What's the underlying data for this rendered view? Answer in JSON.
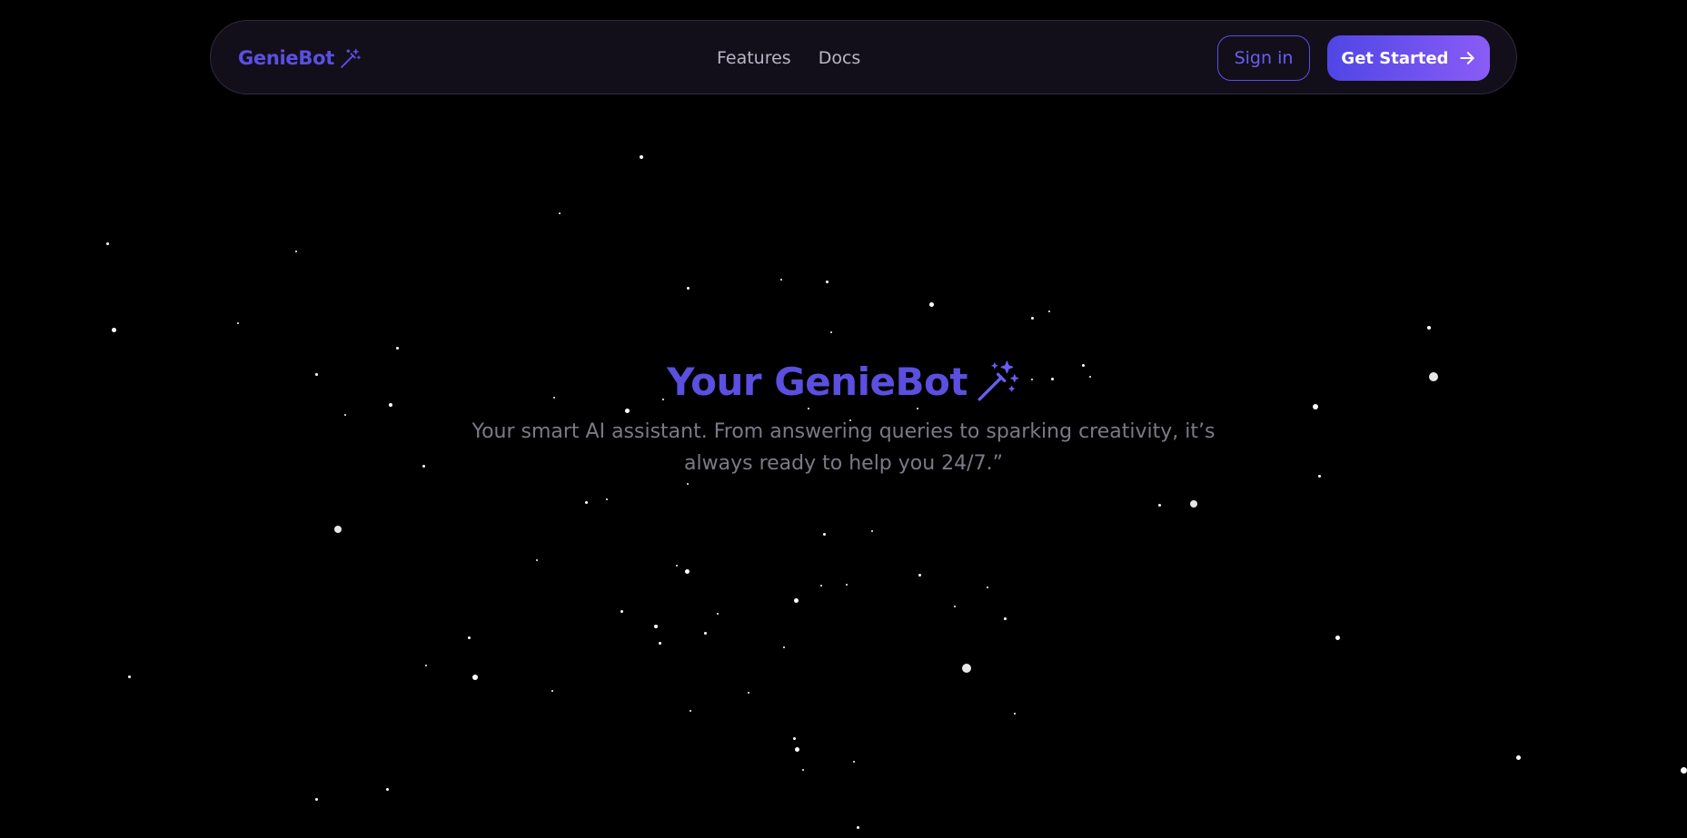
{
  "nav": {
    "brand": "GenieBot",
    "links": [
      {
        "label": "Features"
      },
      {
        "label": "Docs"
      }
    ],
    "signin_label": "Sign in",
    "getstarted_label": "Get Started"
  },
  "hero": {
    "title": "Your GenieBot",
    "subtitle": "Your smart AI assistant. From answering queries to sparking creativity, it’s always ready to help you 24/7.”"
  },
  "icons": {
    "brand_icon": "magic-wand-icon",
    "title_icon": "magic-wand-sparkles-icon",
    "button_icon": "arrow-right-icon"
  },
  "colors": {
    "background": "#000000",
    "accent": "#5b4fe0",
    "accent_gradient_end": "#8a5cf6",
    "nav_bg": "#120f1b",
    "muted_text": "#7c7a86",
    "star": "#ffffff"
  }
}
